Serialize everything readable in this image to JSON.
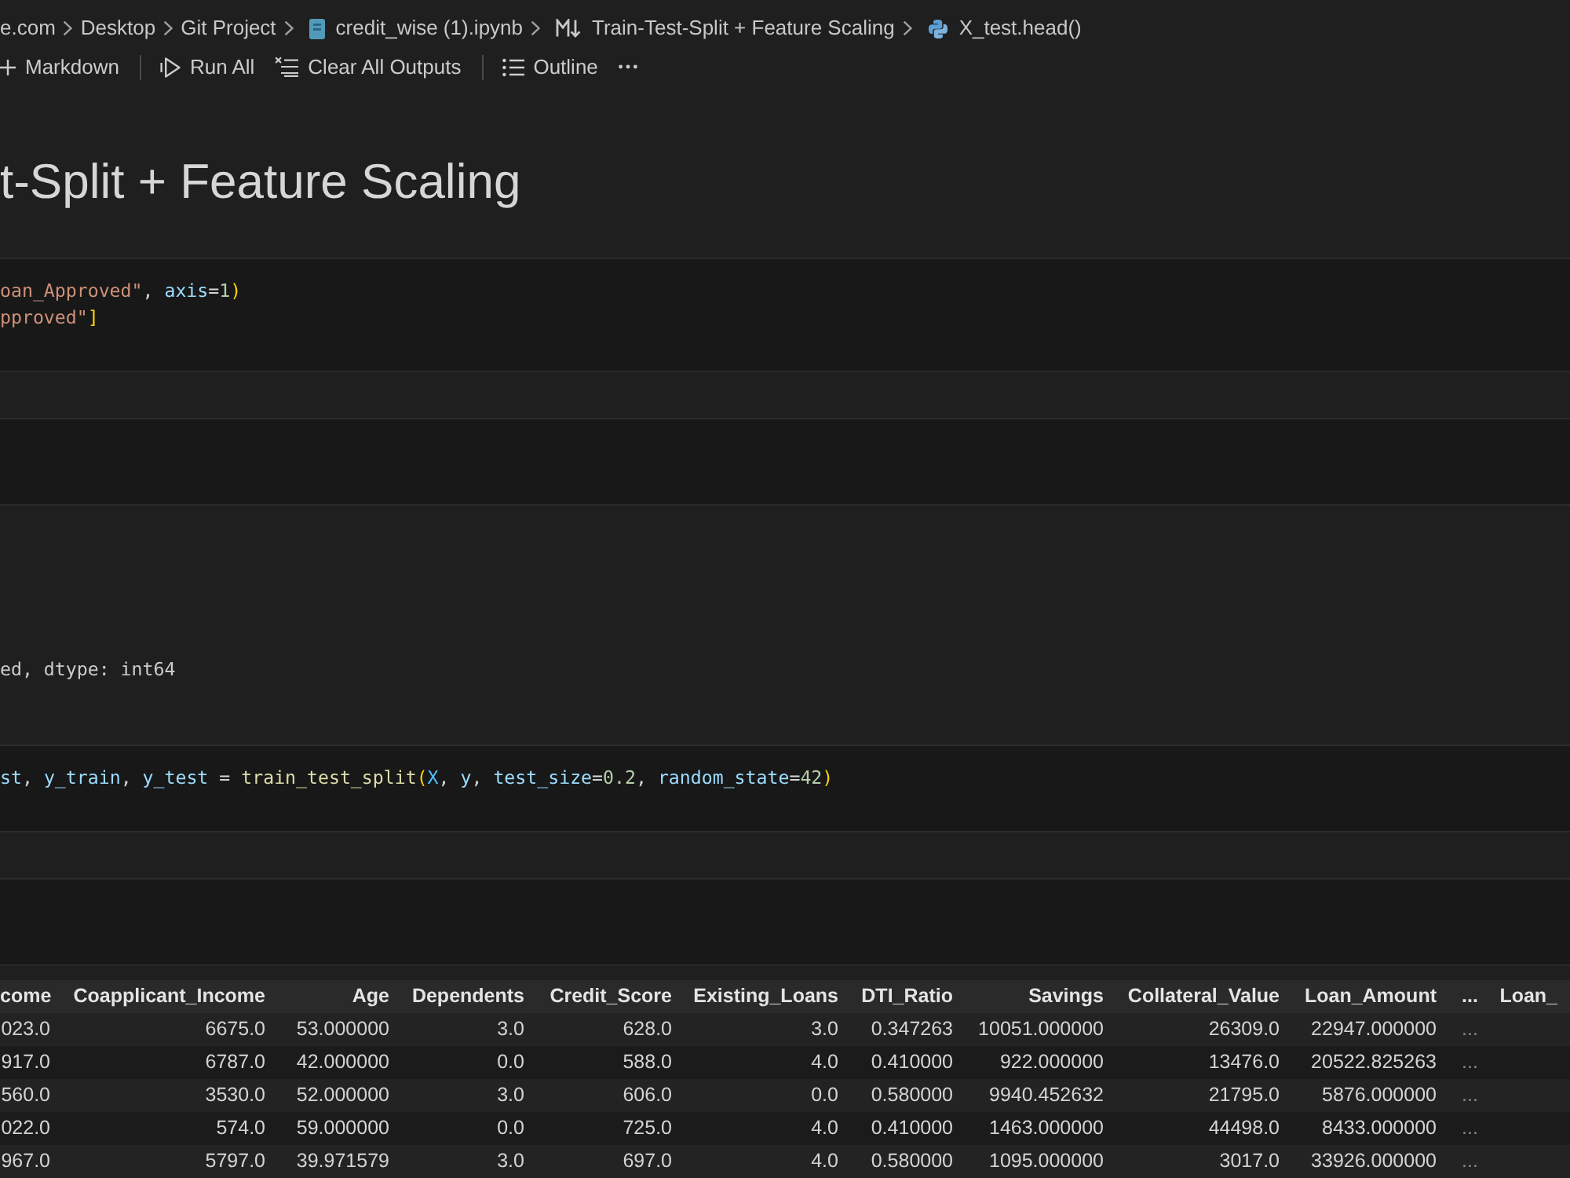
{
  "breadcrumbs": [
    {
      "kind": "path",
      "label": "e.com"
    },
    {
      "kind": "path",
      "label": "Desktop"
    },
    {
      "kind": "path",
      "label": "Git Project"
    },
    {
      "kind": "notebook",
      "label": "credit_wise (1).ipynb"
    },
    {
      "kind": "markdown",
      "label": "Train-Test-Split + Feature Scaling"
    },
    {
      "kind": "python",
      "label": "X_test.head()"
    }
  ],
  "toolbar": [
    {
      "kind": "add",
      "label": "Markdown"
    },
    {
      "kind": "separator"
    },
    {
      "kind": "run_all",
      "label": "Run All"
    },
    {
      "kind": "clear",
      "label": "Clear All Outputs"
    },
    {
      "kind": "separator"
    },
    {
      "kind": "outline",
      "label": "Outline"
    },
    {
      "kind": "more"
    }
  ],
  "cells": [
    {
      "kind": "markdown",
      "heading": "t-Split + Feature Scaling"
    },
    {
      "kind": "code",
      "lines": [
        [
          {
            "kind": "string",
            "text": "oan_Approved\""
          },
          {
            "kind": "plain",
            "text": ", "
          },
          {
            "kind": "variable",
            "text": "axis"
          },
          {
            "kind": "plain",
            "text": "="
          },
          {
            "kind": "number",
            "text": "1"
          },
          {
            "kind": "bracket",
            "text": ")"
          }
        ],
        [
          {
            "kind": "string",
            "text": "pproved\""
          },
          {
            "kind": "bracket",
            "text": "]"
          }
        ]
      ]
    },
    {
      "kind": "output"
    },
    {
      "kind": "code"
    },
    {
      "kind": "output",
      "text": "ed, dtype: int64"
    },
    {
      "kind": "code",
      "lines": [
        [
          {
            "kind": "variable",
            "text": "st"
          },
          {
            "kind": "plain",
            "text": ", "
          },
          {
            "kind": "variable",
            "text": "y_train"
          },
          {
            "kind": "plain",
            "text": ", "
          },
          {
            "kind": "variable",
            "text": "y_test"
          },
          {
            "kind": "plain",
            "text": " = "
          },
          {
            "kind": "function",
            "text": "train_test_split"
          },
          {
            "kind": "bracket",
            "text": "("
          },
          {
            "kind": "constant",
            "text": "X"
          },
          {
            "kind": "plain",
            "text": ", "
          },
          {
            "kind": "variable",
            "text": "y"
          },
          {
            "kind": "plain",
            "text": ", "
          },
          {
            "kind": "variable",
            "text": "test_size"
          },
          {
            "kind": "plain",
            "text": "="
          },
          {
            "kind": "number",
            "text": "0.2"
          },
          {
            "kind": "plain",
            "text": ", "
          },
          {
            "kind": "variable",
            "text": "random_state"
          },
          {
            "kind": "plain",
            "text": "="
          },
          {
            "kind": "number",
            "text": "42"
          },
          {
            "kind": "bracket",
            "text": ")"
          }
        ]
      ]
    },
    {
      "kind": "output"
    },
    {
      "kind": "code"
    },
    {
      "kind": "output",
      "table": {
        "columns": [
          {
            "kind": "data",
            "label": "come"
          },
          {
            "kind": "data",
            "label": "Coapplicant_Income"
          },
          {
            "kind": "data",
            "label": "Age"
          },
          {
            "kind": "data",
            "label": "Dependents"
          },
          {
            "kind": "data",
            "label": "Credit_Score"
          },
          {
            "kind": "data",
            "label": "Existing_Loans"
          },
          {
            "kind": "data",
            "label": "DTI_Ratio"
          },
          {
            "kind": "data",
            "label": "Savings"
          },
          {
            "kind": "data",
            "label": "Collateral_Value"
          },
          {
            "kind": "data",
            "label": "Loan_Amount"
          },
          {
            "kind": "ellipsis",
            "label": "..."
          },
          {
            "kind": "data",
            "label": "Loan_"
          }
        ],
        "rows": [
          [
            "023.0",
            "6675.0",
            "53.000000",
            "3.0",
            "628.0",
            "3.0",
            "0.347263",
            "10051.000000",
            "26309.0",
            "22947.000000",
            "..."
          ],
          [
            "917.0",
            "6787.0",
            "42.000000",
            "0.0",
            "588.0",
            "4.0",
            "0.410000",
            "922.000000",
            "13476.0",
            "20522.825263",
            "..."
          ],
          [
            "560.0",
            "3530.0",
            "52.000000",
            "3.0",
            "606.0",
            "0.0",
            "0.580000",
            "9940.452632",
            "21795.0",
            "5876.000000",
            "..."
          ],
          [
            "022.0",
            "574.0",
            "59.000000",
            "0.0",
            "725.0",
            "4.0",
            "0.410000",
            "1463.000000",
            "44498.0",
            "8433.000000",
            "..."
          ],
          [
            "967.0",
            "5797.0",
            "39.971579",
            "3.0",
            "697.0",
            "4.0",
            "0.580000",
            "1095.000000",
            "3017.0",
            "33926.000000",
            "..."
          ]
        ]
      }
    }
  ]
}
